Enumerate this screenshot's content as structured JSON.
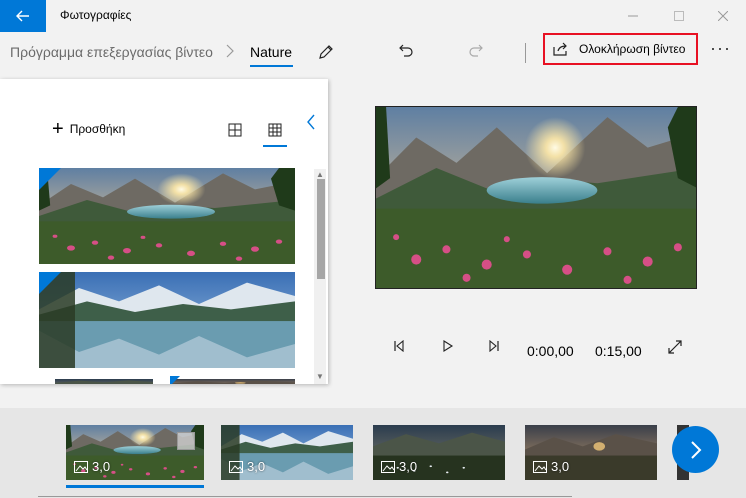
{
  "window": {
    "title": "Φωτογραφίες"
  },
  "breadcrumb": {
    "parent": "Πρόγραμμα επεξεργασίας βίντεο",
    "current": "Nature"
  },
  "toolbar": {
    "finish_label": "Ολοκλήρωση βίντεο",
    "more_label": "···"
  },
  "library": {
    "add_label": "Προσθήκη"
  },
  "player": {
    "current_time": "0:00,00",
    "total_time": "0:15,00"
  },
  "storyboard": {
    "clips": [
      {
        "duration": "3,0"
      },
      {
        "duration": "3,0"
      },
      {
        "duration": "3,0"
      },
      {
        "duration": "3,0"
      }
    ]
  },
  "colors": {
    "accent": "#0078d7",
    "highlight_border": "#e81123"
  }
}
